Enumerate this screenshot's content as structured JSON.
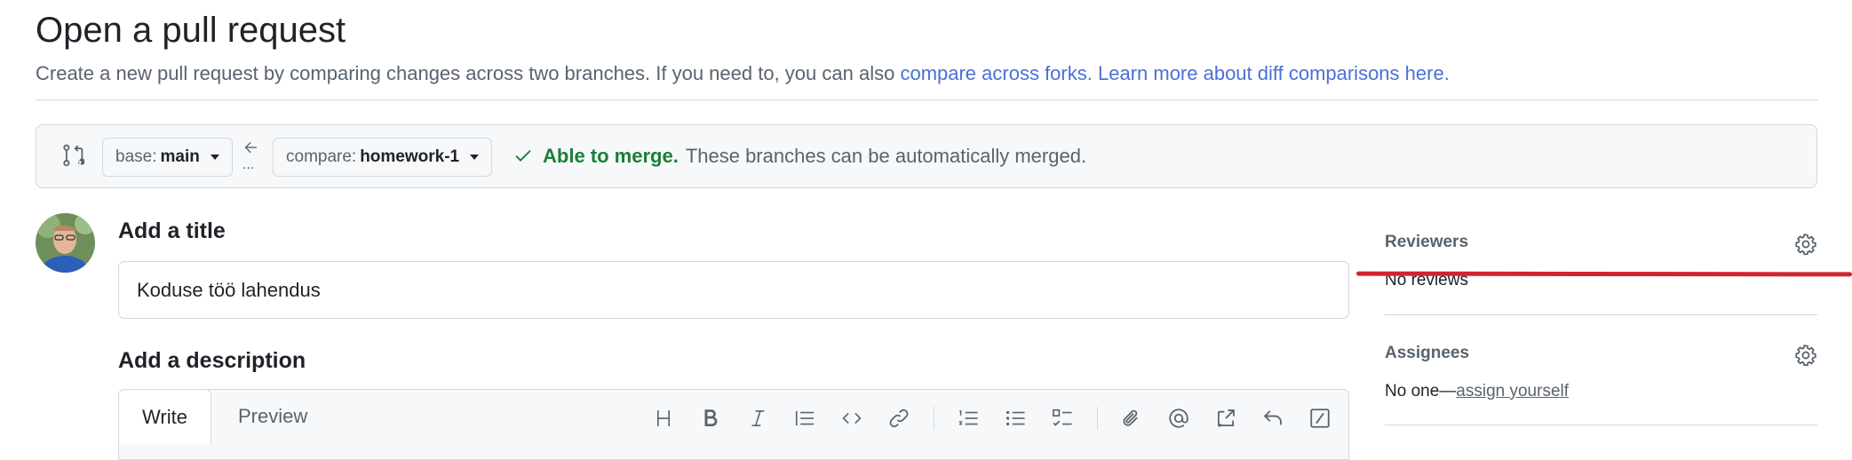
{
  "page": {
    "title": "Open a pull request",
    "subtitle_text": "Create a new pull request by comparing changes across two branches. If you need to, you can also ",
    "link_compare_forks": "compare across forks.",
    "link_learn_more": "Learn more about diff comparisons here."
  },
  "range": {
    "base_label": "base:",
    "base_value": "main",
    "compare_label": "compare:",
    "compare_value": "homework-1",
    "ellipsis": "...",
    "merge_ok": "Able to merge.",
    "merge_text": "These branches can be automatically merged."
  },
  "form": {
    "title_heading": "Add a title",
    "title_value": "Koduse töö lahendus",
    "description_heading": "Add a description",
    "tabs": [
      "Write",
      "Preview"
    ],
    "toolbar_icons": [
      "heading-icon",
      "bold-icon",
      "italic-icon",
      "quote-icon",
      "code-icon",
      "link-icon",
      "numbered-list-icon",
      "unordered-list-icon",
      "task-list-icon",
      "attach-icon",
      "mention-icon",
      "reference-icon",
      "reply-icon",
      "slash-command-icon"
    ]
  },
  "sidebar": {
    "reviewers_heading": "Reviewers",
    "reviewers_value": "No reviews",
    "assignees_heading": "Assignees",
    "assignees_prefix": "No one—",
    "assignees_link": "assign yourself"
  },
  "colors": {
    "accent_link": "#4c6fd6",
    "success": "#1a7f37",
    "annotation_red": "#d1242f"
  }
}
